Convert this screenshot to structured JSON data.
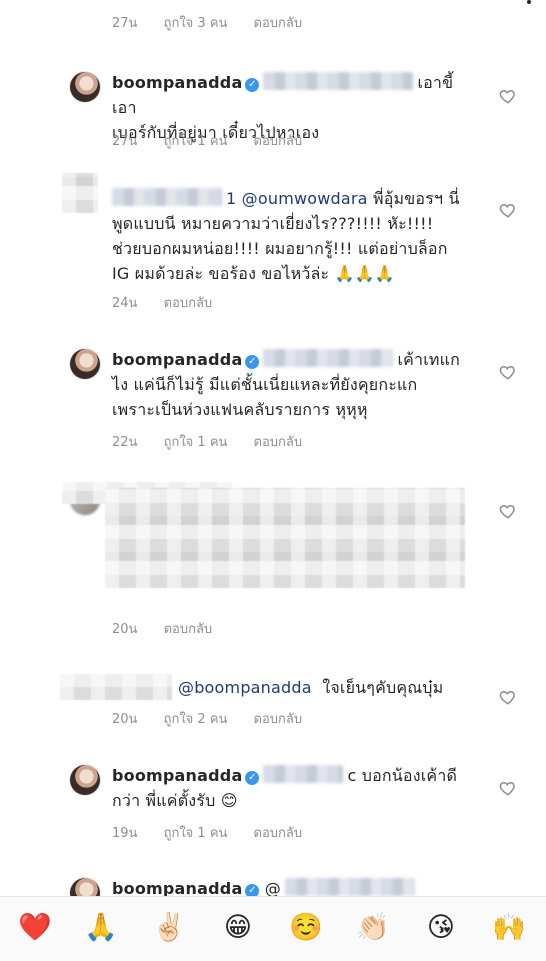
{
  "comments": [
    {
      "partial": true,
      "time": "27น",
      "likes": "ถูกใจ 3 คน",
      "reply": "ตอบกลับ"
    },
    {
      "user": "boompanadda",
      "line1": "เอาขี้ เอา",
      "line2": "เบอร์กับที่อยู่มา เดี๋ยวไปหาเอง",
      "time": "27น",
      "likes": "ถูกใจ 1 คน",
      "reply": "ตอบกลับ"
    },
    {
      "mention": "1 @oumwowdara",
      "line1": "พี่อุ้มขอรฯ นี่",
      "line2": "พูดแบบนี หมายความว่าเยี่ยงไร???!!!! หัะ!!!!",
      "line3": "ช่วยบอกผมหน่อย!!!! ผมอยากรู้!!! แต่อย่าบล็อก",
      "line4": "IG ผมด้วยล่ะ ขอร้อง ขอไหว้ล่ะ 🙏🙏🙏",
      "time": "24น",
      "reply": "ตอบกลับ"
    },
    {
      "user": "boompanadda",
      "line1": "เค้าเทแก",
      "line2": "ไง แค่นีก็ไม่รู้ มีแต่ชั้นเนี่ยแหละที่ยังคุยกะแก",
      "line3": "เพราะเป็นห่วงแฟนคลับรายการ หุหุหุ",
      "time": "22น",
      "likes": "ถูกใจ 1 คน",
      "reply": "ตอบกลับ"
    },
    {
      "time": "20น",
      "reply": "ตอบกลับ"
    },
    {
      "mention": "@boompanadda",
      "line1": "ใจเย็นๆคับคุณบุ๋ม",
      "time": "20น",
      "likes": "ถูกใจ 2 คน",
      "reply": "ตอบกลับ"
    },
    {
      "user": "boompanadda",
      "line1": "c บอกน้องเค้าดี",
      "line2": "กว่า พี่แค่ตั้งรับ 😊",
      "time": "19น",
      "likes": "ถูกใจ 1 คน",
      "reply": "ตอบกลับ"
    },
    {
      "user": "boompanadda",
      "line1": "@"
    }
  ],
  "emoji_bar": [
    "❤️",
    "🙏",
    "✌🏻",
    "😁",
    "☺️",
    "👏🏻",
    "😘",
    "🙌"
  ],
  "colors": {
    "text": "#262626",
    "meta": "#8e8e8e",
    "verified": "#3897f0",
    "mention": "#1f3b70"
  },
  "icons": {
    "like": "heart-outline-icon",
    "verified": "verified-badge-icon"
  }
}
